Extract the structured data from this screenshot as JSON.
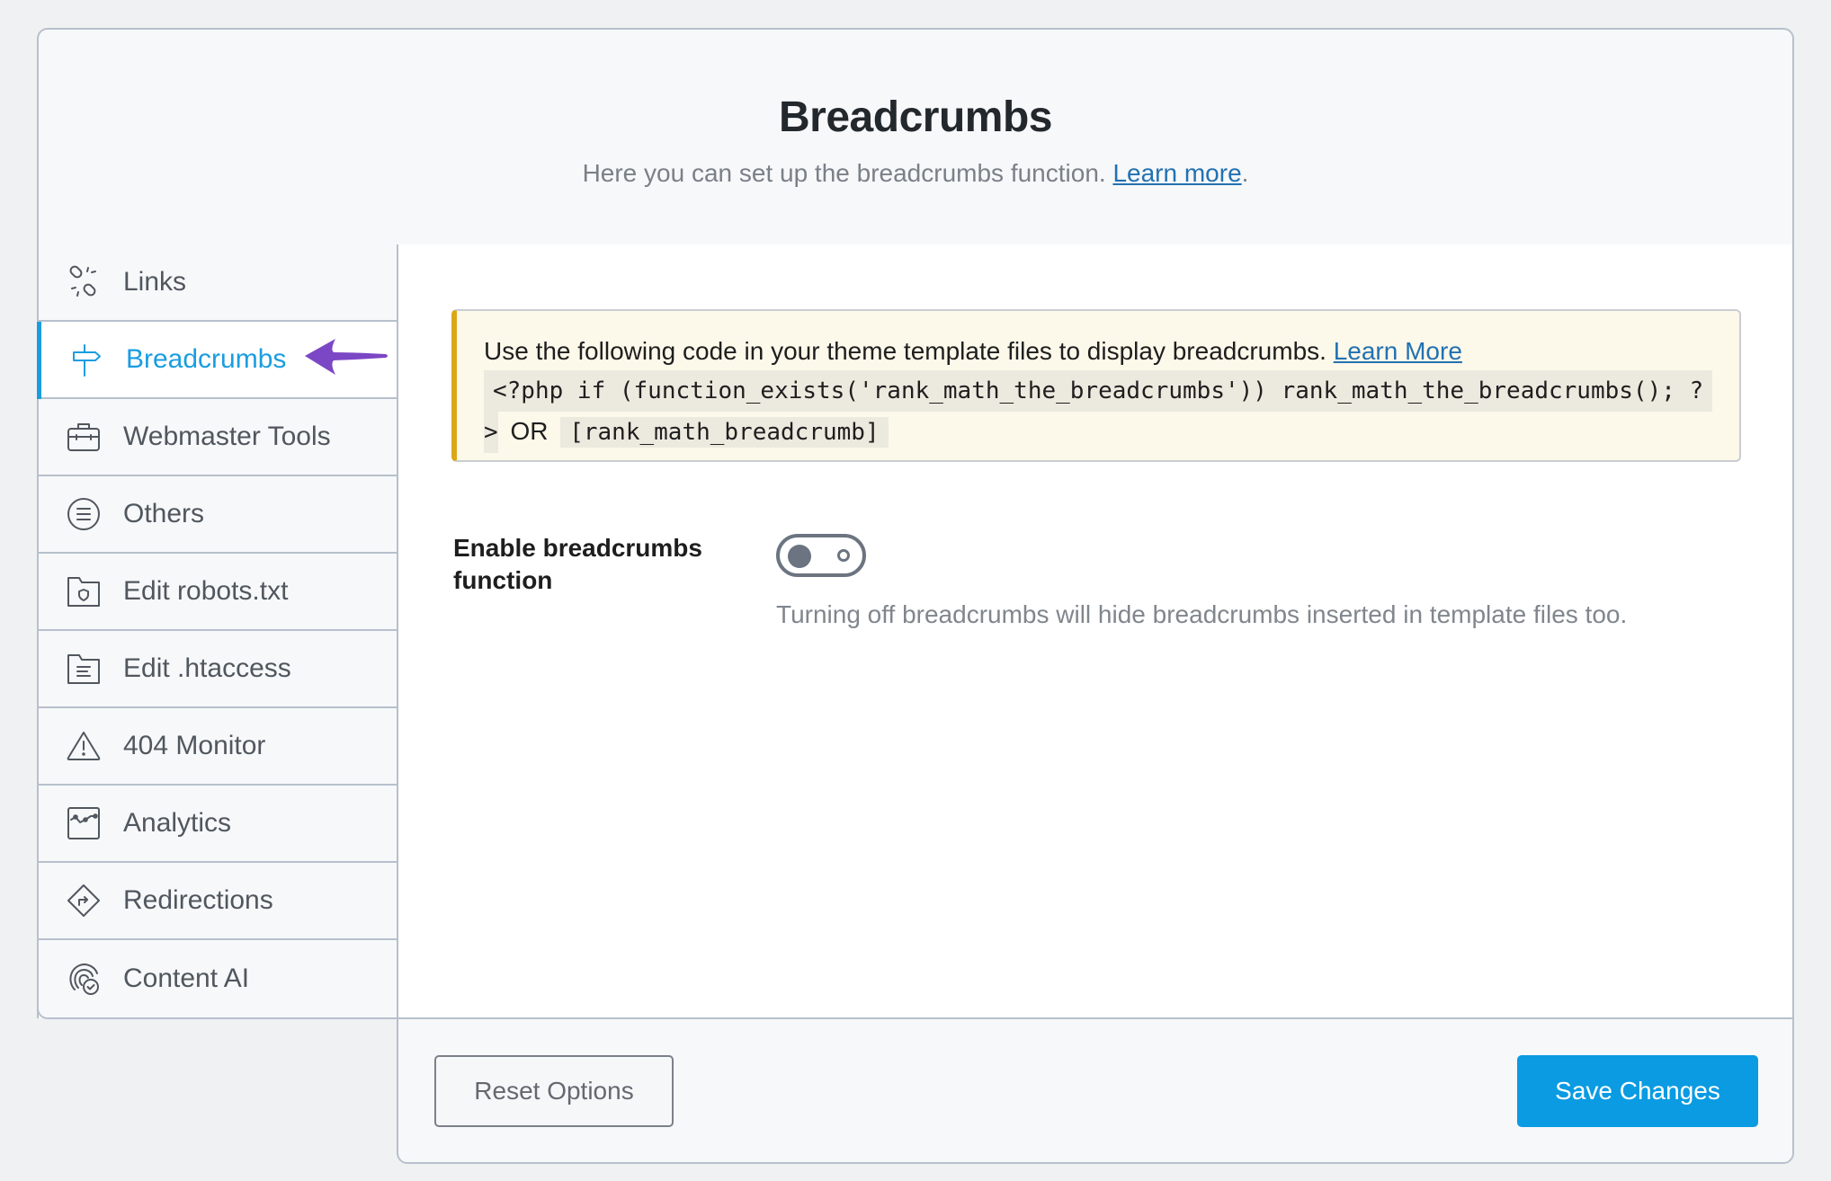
{
  "header": {
    "title": "Breadcrumbs",
    "subtitle": "Here you can set up the breadcrumbs function.",
    "learn_more": "Learn more",
    "trailing_period": "."
  },
  "sidebar": {
    "items": [
      {
        "label": "Links",
        "icon": "broken-link-icon",
        "active": false
      },
      {
        "label": "Breadcrumbs",
        "icon": "signpost-icon",
        "active": true
      },
      {
        "label": "Webmaster Tools",
        "icon": "toolbox-icon",
        "active": false
      },
      {
        "label": "Others",
        "icon": "list-circle-icon",
        "active": false
      },
      {
        "label": "Edit robots.txt",
        "icon": "folder-shield-icon",
        "active": false
      },
      {
        "label": "Edit .htaccess",
        "icon": "folder-text-icon",
        "active": false
      },
      {
        "label": "404 Monitor",
        "icon": "warning-triangle-icon",
        "active": false
      },
      {
        "label": "Analytics",
        "icon": "chart-line-icon",
        "active": false
      },
      {
        "label": "Redirections",
        "icon": "diamond-arrow-icon",
        "active": false
      },
      {
        "label": "Content AI",
        "icon": "fingerprint-check-icon",
        "active": false
      }
    ]
  },
  "annotation": {
    "arrow_color": "#7b47c4"
  },
  "notice": {
    "text": "Use the following code in your theme template files to display breadcrumbs.",
    "learn_more": "Learn More",
    "code_php_line1": "<?php if (function_exists('rank_math_the_breadcrumbs')) rank_math_the_breadcrumbs(); ?",
    "code_php_line2": ">",
    "or": "OR",
    "code_shortcode": "[rank_math_breadcrumb]"
  },
  "setting": {
    "label": "Enable breadcrumbs function",
    "enabled": false,
    "description": "Turning off breadcrumbs will hide breadcrumbs inserted in template files too."
  },
  "footer": {
    "reset_label": "Reset Options",
    "save_label": "Save Changes"
  },
  "colors": {
    "accent": "#1a9de0",
    "save_button": "#0a9be2",
    "notice_border": "#dba617",
    "link": "#2271b1"
  }
}
